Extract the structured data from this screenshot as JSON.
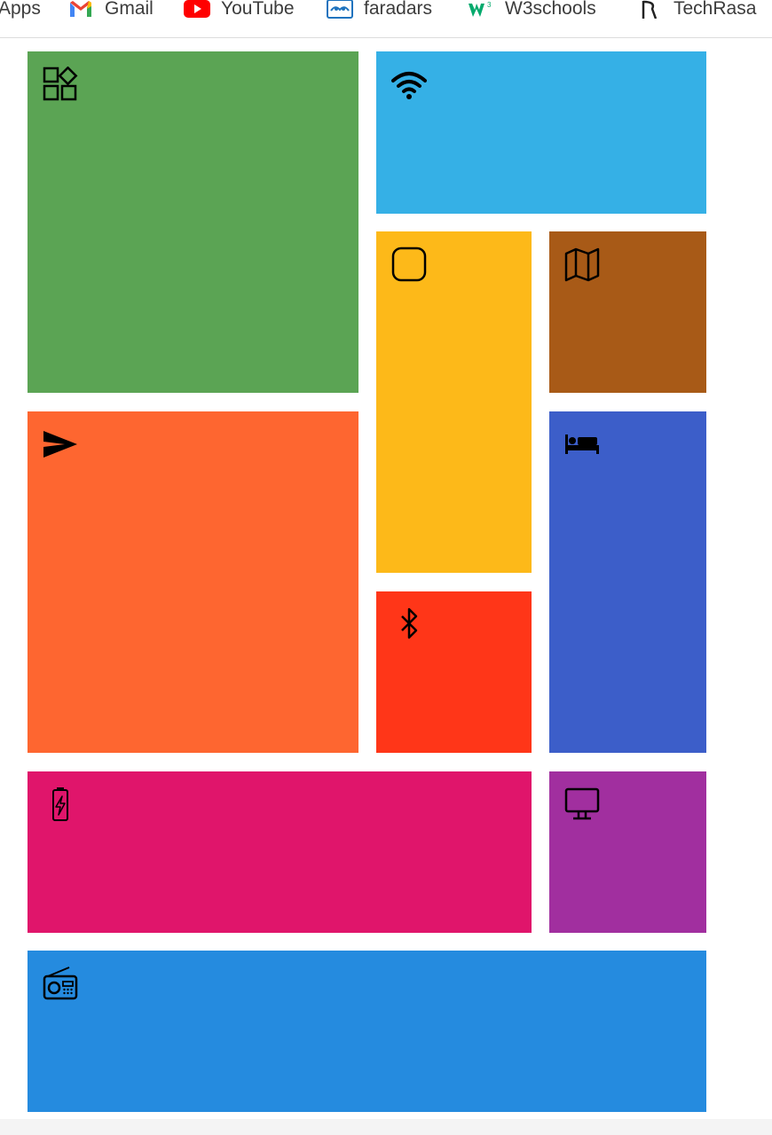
{
  "bookmarks": [
    {
      "label": "Apps",
      "icon": "apps-icon"
    },
    {
      "label": "Gmail",
      "icon": "gmail-icon"
    },
    {
      "label": "YouTube",
      "icon": "youtube-icon"
    },
    {
      "label": "faradars",
      "icon": "faradars-icon"
    },
    {
      "label": "W3schools",
      "icon": "w3schools-icon"
    },
    {
      "label": "TechRasa",
      "icon": "techrasa-icon"
    }
  ],
  "tiles": [
    {
      "name": "apps",
      "icon": "apps-shapes-icon",
      "color": "#5ba454"
    },
    {
      "name": "wifi",
      "icon": "wifi-icon",
      "color": "#35b0e6"
    },
    {
      "name": "square",
      "icon": "rounded-square-icon",
      "color": "#fdb919"
    },
    {
      "name": "map",
      "icon": "map-icon",
      "color": "#a85a17"
    },
    {
      "name": "send",
      "icon": "send-icon",
      "color": "#fe6630"
    },
    {
      "name": "bed",
      "icon": "bed-icon",
      "color": "#3c5ec9"
    },
    {
      "name": "bluetooth",
      "icon": "bluetooth-icon",
      "color": "#ff3618"
    },
    {
      "name": "battery",
      "icon": "battery-charging-icon",
      "color": "#e0156b"
    },
    {
      "name": "monitor",
      "icon": "monitor-icon",
      "color": "#a12f9f"
    },
    {
      "name": "radio",
      "icon": "radio-icon",
      "color": "#258bdf"
    }
  ]
}
